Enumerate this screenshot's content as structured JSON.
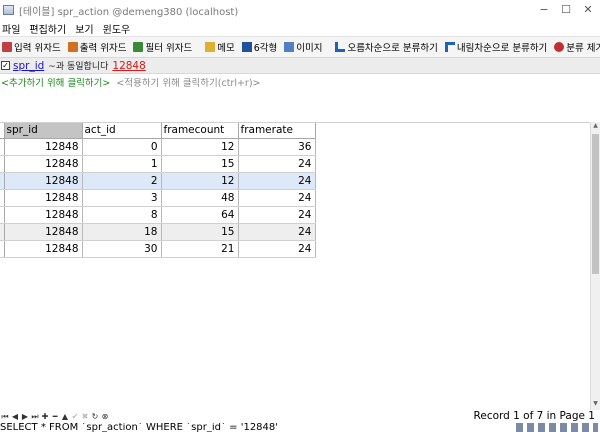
{
  "window": {
    "title": "[테이블] spr_action @demeng380 (localhost)",
    "controls": {
      "minimize": "−",
      "maximize": "☐",
      "close": "✕"
    }
  },
  "menu": [
    "파일",
    "편집하기",
    "보기",
    "윈도우"
  ],
  "toolbar": {
    "items": [
      {
        "label": "입력 위자드",
        "icon": "input-wizard-icon",
        "color": "#c04040"
      },
      {
        "label": "출력 위자드",
        "icon": "output-wizard-icon",
        "color": "#d07020"
      },
      {
        "label": "필터 위자드",
        "icon": "filter-wizard-icon",
        "color": "#3a8a3a"
      },
      {
        "label": "메모",
        "icon": "memo-icon",
        "color": "#e0b030"
      },
      {
        "label": "6각형",
        "icon": "hex-icon",
        "color": "#2050a0"
      },
      {
        "label": "이미지",
        "icon": "image-icon",
        "color": "#5080c0"
      },
      {
        "label": "오름차순으로 분류하기",
        "icon": "sort-ascending-icon",
        "color": "#2060c0"
      },
      {
        "label": "내림차순으로 분류하기",
        "icon": "sort-descending-icon",
        "color": "#2060c0"
      },
      {
        "label": "분류 제거하기",
        "icon": "clear-sort-icon",
        "color": "#c03030"
      }
    ]
  },
  "filter": {
    "column": "spr_id",
    "operator": "~과 동일합니다",
    "value": "12848",
    "add_hint": "<추가하기 위해 클릭하기>",
    "apply_hint": "<적용하기 위해 클릭하기(ctrl+r)>"
  },
  "grid": {
    "columns": [
      "spr_id",
      "act_id",
      "framecount",
      "framerate"
    ],
    "rows": [
      [
        "12848",
        "0",
        "12",
        "36"
      ],
      [
        "12848",
        "1",
        "15",
        "24"
      ],
      [
        "12848",
        "2",
        "12",
        "24"
      ],
      [
        "12848",
        "3",
        "48",
        "24"
      ],
      [
        "12848",
        "8",
        "64",
        "24"
      ],
      [
        "12848",
        "18",
        "15",
        "24"
      ],
      [
        "12848",
        "30",
        "21",
        "24"
      ]
    ]
  },
  "navigator": {
    "record_text": "Record 1 of 7 in Page 1"
  },
  "sql": "SELECT * FROM `spr_action` WHERE `spr_id` = '12848'"
}
